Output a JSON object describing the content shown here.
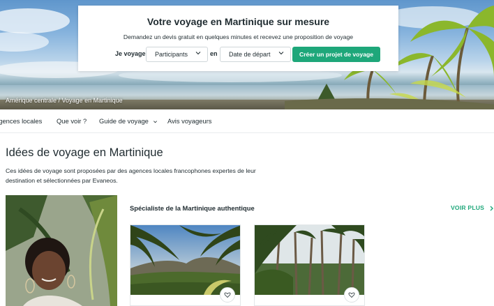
{
  "hero": {
    "title": "Votre voyage en Martinique sur mesure",
    "subtitle": "Demandez un devis gratuit en quelques minutes et recevez une proposition de voyage",
    "label": "Je voyage",
    "participants_value": "Participants",
    "connector": "en",
    "date_value": "Date de départ",
    "cta_label": "Créer un projet de voyage",
    "breadcrumb": "Amérique centrale / Voyage en Martinique"
  },
  "nav": {
    "items": [
      {
        "label": "Agences locales"
      },
      {
        "label": "Que voir ?"
      },
      {
        "label": "Guide de voyage"
      },
      {
        "label": "Avis voyageurs"
      }
    ]
  },
  "main": {
    "title": "Idées de voyage en Martinique",
    "intro": "Ces idées de voyage sont proposées par des agences locales francophones expertes de leur destination et sélectionnées par Evaneos.",
    "section_title": "Spécialiste de la Martinique authentique",
    "see_more": "VOIR PLUS"
  },
  "colors": {
    "accent": "#1ea77a",
    "text": "#1f2b30",
    "border": "#cfd6d9"
  },
  "icons": [
    "chevron-down-icon",
    "arrow-right-icon",
    "heart-icon"
  ]
}
